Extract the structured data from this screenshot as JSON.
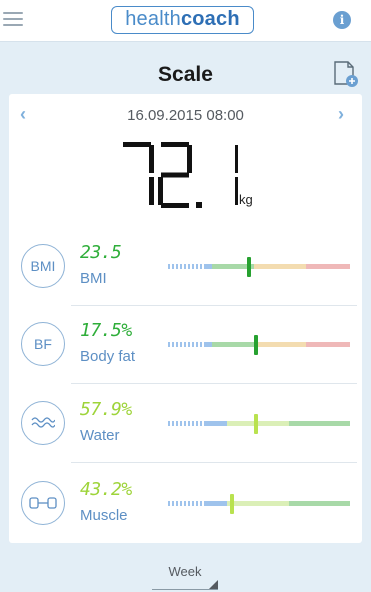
{
  "header": {
    "logo_prefix": "health",
    "logo_suffix": "coach",
    "info_label": "i"
  },
  "page": {
    "title": "Scale"
  },
  "measurement": {
    "date": "16.09.2015 08:00",
    "weight": "72.1",
    "unit": "kg"
  },
  "metrics": [
    {
      "icon_text": "BMI",
      "value": "23.5",
      "label": "BMI",
      "value_color": "#2fae3a",
      "level": 0.45,
      "scale": [
        "#9fc3ec",
        "#a8d9a8",
        "#f3dcb0",
        "#efb8b8"
      ]
    },
    {
      "icon_text": "BF",
      "value": "17.5%",
      "label": "Body fat",
      "value_color": "#2fae3a",
      "level": 0.49,
      "scale": [
        "#9fc3ec",
        "#a8d9a8",
        "#f3dcb0",
        "#efb8b8"
      ]
    },
    {
      "icon_text": "",
      "icon": "water-wave-icon",
      "value": "57.9%",
      "label": "Water",
      "value_color": "#9ed43a",
      "level": 0.49,
      "scale": [
        "#9fc3ec",
        "#dbefb7",
        "#a8d9a8"
      ]
    },
    {
      "icon_text": "",
      "icon": "muscle-dumbbell-icon",
      "value": "43.2%",
      "label": "Muscle",
      "value_color": "#9ed43a",
      "level": 0.36,
      "scale": [
        "#9fc3ec",
        "#dbefb7",
        "#a8d9a8"
      ]
    }
  ],
  "marker_colors": [
    "#27a130",
    "#27a130",
    "#b9e24f",
    "#b9e24f"
  ],
  "footer": {
    "period": "Week"
  }
}
